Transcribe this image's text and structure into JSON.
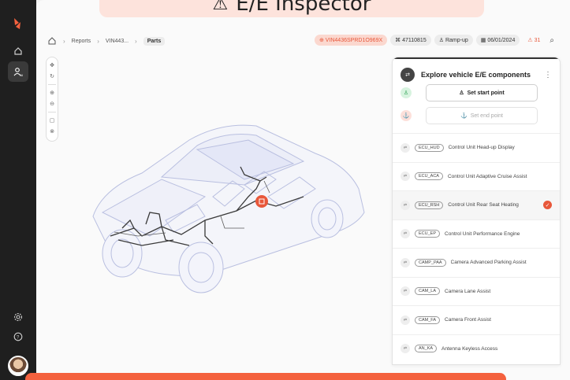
{
  "title": "E/E Inspector",
  "breadcrumb": {
    "items": [
      "Reports",
      "VIN443..."
    ],
    "current": "Parts"
  },
  "header_chips": {
    "vin": "VIN4436SPRD1O969X",
    "part_number": "47110815",
    "phase": "Ramp-up",
    "date": "06/01/2024",
    "alerts": "31"
  },
  "panel": {
    "title": "Explore vehicle E/E components",
    "start_point_label": "Set start point",
    "end_point_label": "Set end point",
    "components": [
      {
        "code": "ECU_HUD",
        "name": "Control Unit Head-up Display",
        "selected": false
      },
      {
        "code": "ECU_ACA",
        "name": "Control Unit Adaptive Cruise Assist",
        "selected": false
      },
      {
        "code": "ECU_RSH",
        "name": "Control Unit Rear Seat Heating",
        "selected": true
      },
      {
        "code": "ECU_EP",
        "name": "Control Unit Performance Engine",
        "selected": false
      },
      {
        "code": "CAMP_PAA",
        "name": "Camera Advanced Parking Assist",
        "selected": false
      },
      {
        "code": "CAM_LA",
        "name": "Camera Lane Assist",
        "selected": false
      },
      {
        "code": "CAM_FA",
        "name": "Camera Front Assist",
        "selected": false
      },
      {
        "code": "AN_KA",
        "name": "Antenna Keyless Access",
        "selected": false
      }
    ]
  },
  "colors": {
    "accent": "#f4613e",
    "rail": "#1f1f1f",
    "banner": "#fde3dc"
  },
  "icons": {
    "rail": [
      "logo-icon",
      "home-icon",
      "user-ai-icon",
      "settings-icon",
      "help-icon"
    ],
    "tools": [
      "move-icon",
      "rotate-icon",
      "zoom-in-icon",
      "zoom-out-icon",
      "frame-icon",
      "reset-icon"
    ]
  }
}
